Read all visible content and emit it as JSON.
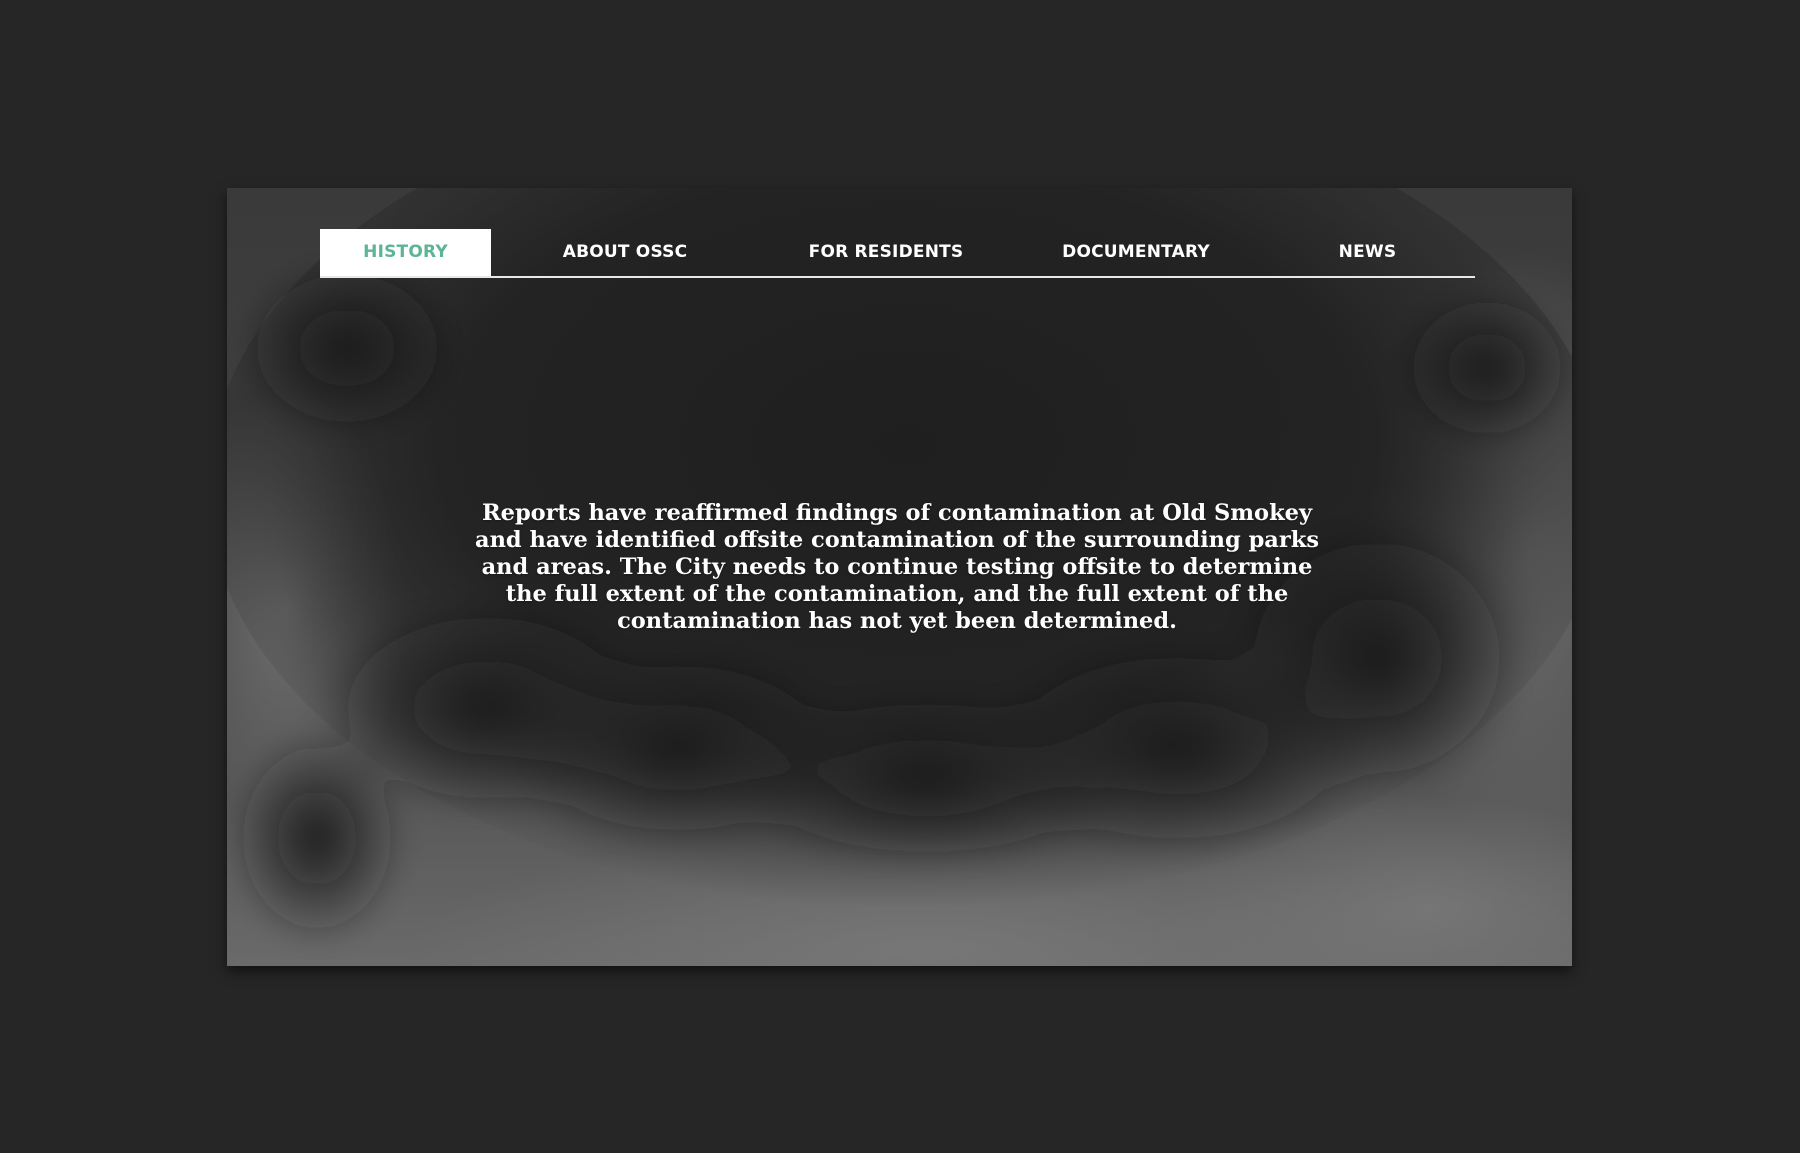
{
  "nav": {
    "active_color": "#5cb594",
    "items": [
      {
        "label": "HISTORY",
        "active": true
      },
      {
        "label": "ABOUT OSSC",
        "active": false
      },
      {
        "label": "FOR RESIDENTS",
        "active": false
      },
      {
        "label": "DOCUMENTARY",
        "active": false
      },
      {
        "label": "NEWS",
        "active": false
      }
    ]
  },
  "hero": {
    "background": "smoke-clouds-image",
    "message": "Reports have reaffirmed findings of contamination at Old Smokey and have identified offsite contamination of the surrounding parks and areas. The City needs to continue testing offsite to determine the full extent of the contamination, and the full extent of the contamination has not yet been determined."
  }
}
